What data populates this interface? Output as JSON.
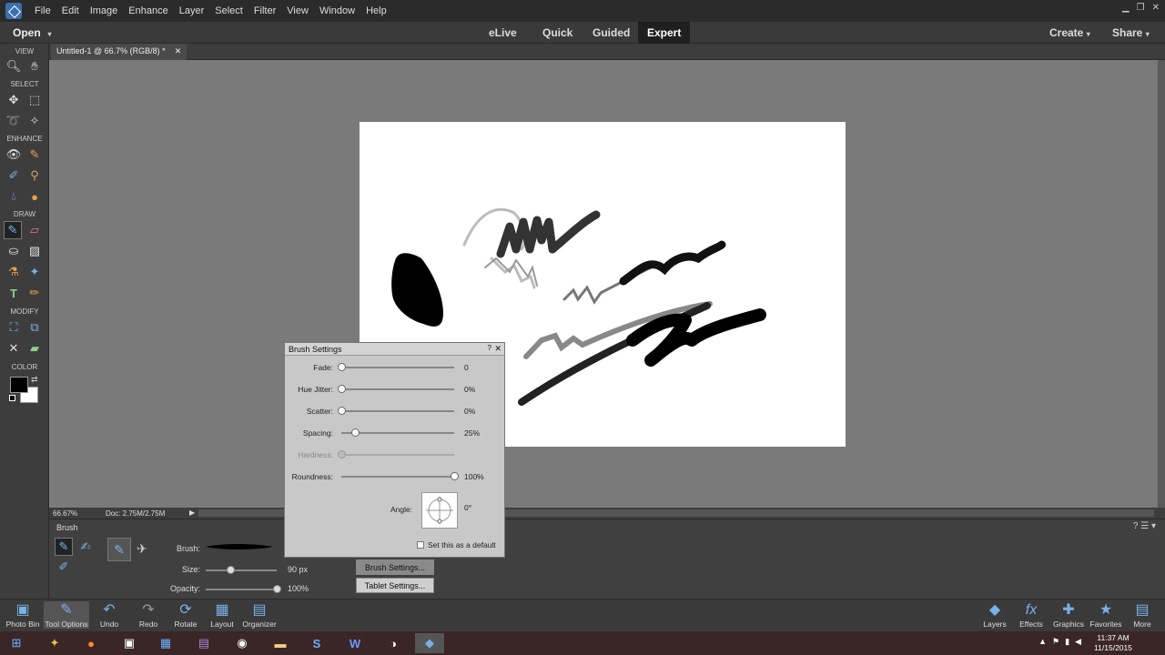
{
  "menu": [
    "File",
    "Edit",
    "Image",
    "Enhance",
    "Layer",
    "Select",
    "Filter",
    "View",
    "Window",
    "Help"
  ],
  "modebar": {
    "open_label": "Open",
    "modes": [
      "eLive",
      "Quick",
      "Guided",
      "Expert"
    ],
    "active_mode": "Expert",
    "create_label": "Create",
    "share_label": "Share"
  },
  "document": {
    "tab_title": "Untitled-1 @ 66.7% (RGB/8) *",
    "zoom": "66.67%",
    "doc_info": "Doc: 2.75M/2.75M"
  },
  "toolbox": {
    "sections": [
      "VIEW",
      "SELECT",
      "ENHANCE",
      "DRAW",
      "MODIFY",
      "COLOR"
    ]
  },
  "tool_options": {
    "title": "Brush",
    "brush_label": "Brush:",
    "size_label": "Size:",
    "size_value": "90 px",
    "size_fraction": 0.35,
    "opacity_label": "Opacity:",
    "opacity_value": "100%",
    "opacity_fraction": 1.0,
    "brush_settings_button": "Brush Settings...",
    "tablet_settings_button": "Tablet Settings..."
  },
  "brush_dialog": {
    "title": "Brush Settings",
    "rows": [
      {
        "label": "Fade:",
        "value": "0",
        "fraction": 0.0,
        "enabled": true
      },
      {
        "label": "Hue Jitter:",
        "value": "0%",
        "fraction": 0.0,
        "enabled": true
      },
      {
        "label": "Scatter:",
        "value": "0%",
        "fraction": 0.0,
        "enabled": true
      },
      {
        "label": "Spacing:",
        "value": "25%",
        "fraction": 0.12,
        "enabled": true
      },
      {
        "label": "Hardness:",
        "value": "",
        "fraction": 0.0,
        "enabled": false
      },
      {
        "label": "Roundness:",
        "value": "100%",
        "fraction": 1.0,
        "enabled": true
      }
    ],
    "angle_label": "Angle:",
    "angle_value": "0°",
    "default_checkbox_label": "Set this as a default",
    "default_checked": false
  },
  "bottom_left": [
    "Photo Bin",
    "Tool Options",
    "Undo",
    "Redo",
    "Rotate",
    "Layout",
    "Organizer"
  ],
  "bottom_right": [
    "Layers",
    "Effects",
    "Graphics",
    "Favorites",
    "More"
  ],
  "clock": {
    "time": "11:37 AM",
    "date": "11/15/2015"
  },
  "colors": {
    "foreground": "#000000",
    "background": "#ffffff",
    "accent": "#1f1f1f"
  }
}
